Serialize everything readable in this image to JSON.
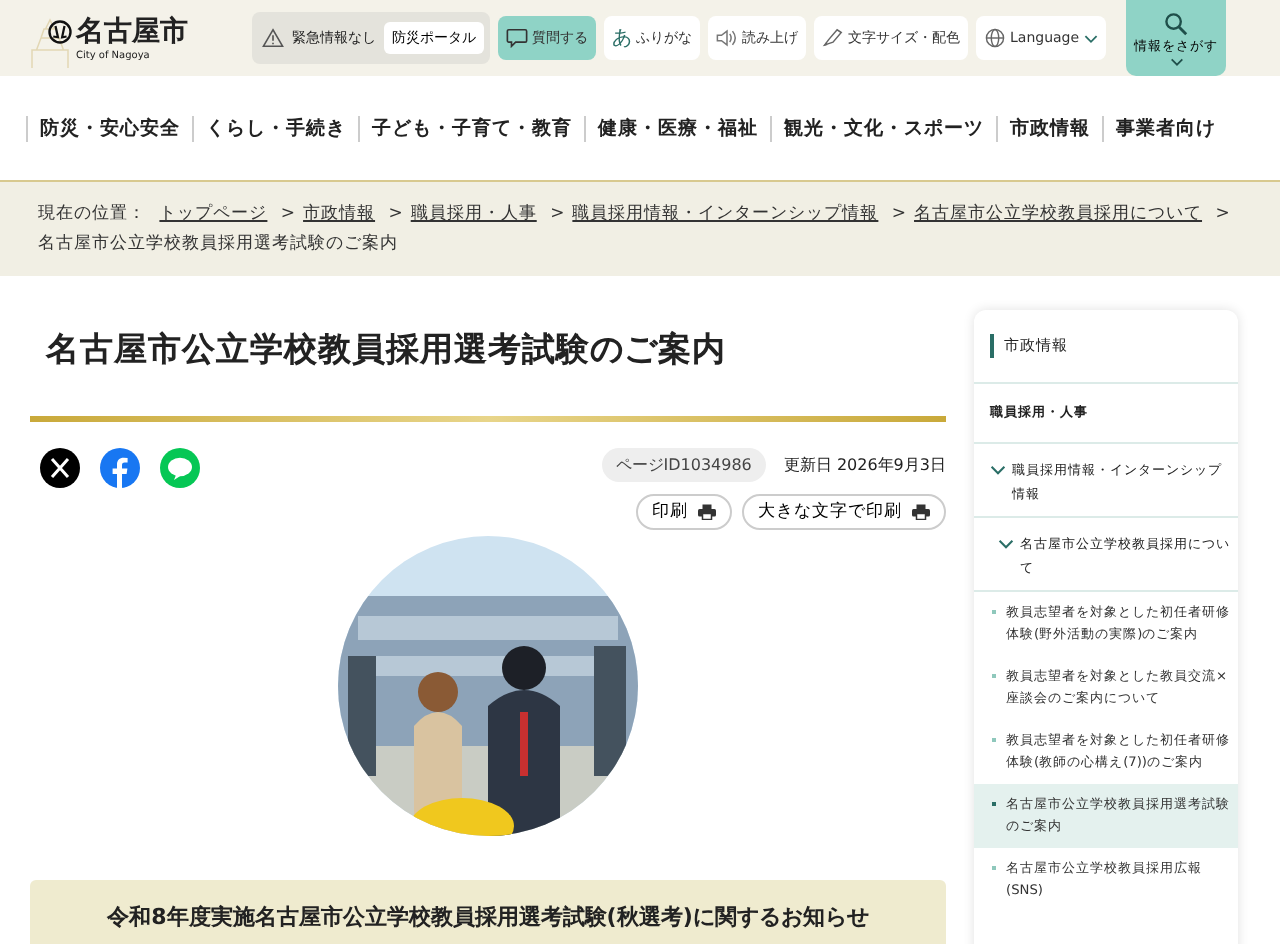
{
  "header": {
    "logo": {
      "name": "名古屋市",
      "sub": "City of Nagoya"
    },
    "emergency": {
      "status": "緊急情報なし",
      "portal": "防災ポータル"
    },
    "tools": [
      {
        "kind": "question",
        "label": "質問する"
      },
      {
        "kind": "furigana",
        "icon": "あ",
        "label": "ふりがな"
      },
      {
        "kind": "speech",
        "label": "読み上げ"
      },
      {
        "kind": "textsize",
        "label": "文字サイズ・配色"
      },
      {
        "kind": "language",
        "label": "Language"
      }
    ],
    "search": {
      "label": "情報をさがす"
    }
  },
  "nav": [
    "防災・安心安全",
    "くらし・手続き",
    "子ども・子育て・教育",
    "健康・医療・福祉",
    "観光・文化・スポーツ",
    "市政情報",
    "事業者向け"
  ],
  "breadcrumb": {
    "label": "現在の位置：",
    "links": [
      "トップページ",
      "市政情報",
      "職員採用・人事",
      "職員採用情報・インターンシップ情報",
      "名古屋市公立学校教員採用について"
    ],
    "separator": ">",
    "current": "名古屋市公立学校教員採用選考試験のご案内"
  },
  "title": "名古屋市公立学校教員採用選考試験のご案内",
  "page_id": "ページID1034986",
  "updated": "更新日 2026年9月3日",
  "print_buttons": [
    "印刷",
    "大きな文字で印刷"
  ],
  "notice": "令和8年度実施名古屋市公立学校教員採用選考試験(秋選考)に関するお知らせ",
  "sidebar": {
    "heading": "市政情報",
    "items": [
      {
        "label": "職員採用・人事",
        "children": [
          {
            "label": "職員採用情報・インターンシップ情報",
            "expanded": true,
            "children": [
              {
                "label": "名古屋市公立学校教員採用について",
                "expanded": true,
                "children": [
                  {
                    "label": "教員志望者を対象とした初任者研修体験(野外活動の実際)のご案内",
                    "selected": false
                  },
                  {
                    "label": "教員志望者を対象とした教員交流×座談会のご案内について",
                    "selected": false
                  },
                  {
                    "label": "教員志望者を対象とした初任者研修体験(教師の心構え(7))のご案内",
                    "selected": false
                  },
                  {
                    "label": "名古屋市公立学校教員採用選考試験のご案内",
                    "selected": true
                  },
                  {
                    "label": "名古屋市公立学校教員採用広報(SNS)",
                    "selected": false
                  }
                ]
              }
            ]
          }
        ]
      }
    ]
  }
}
